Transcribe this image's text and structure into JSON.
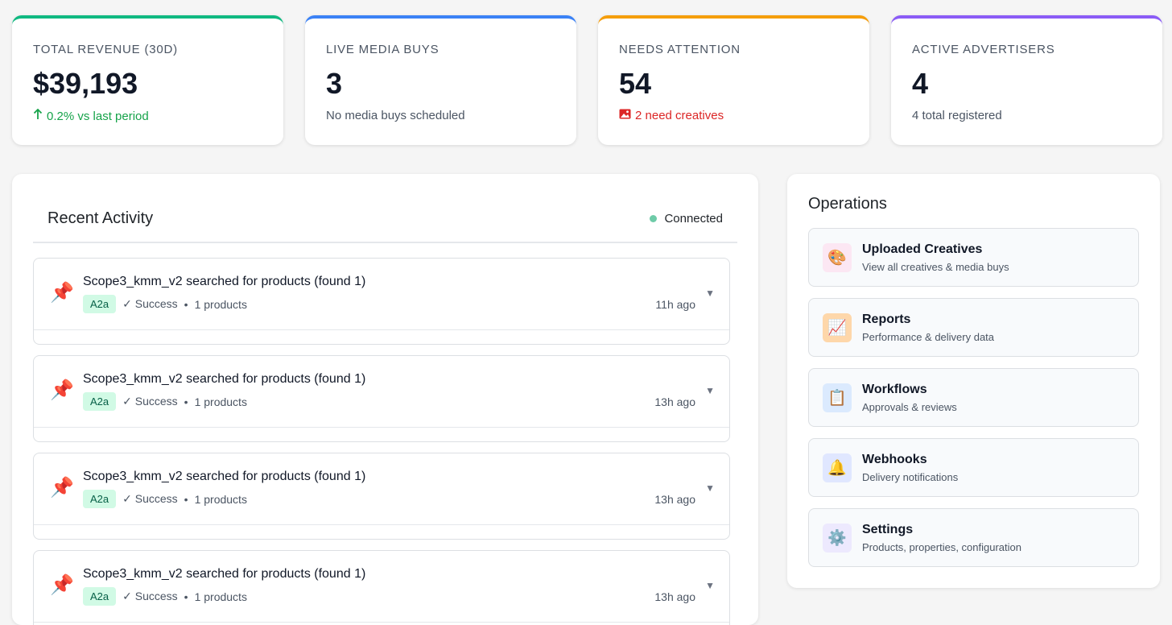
{
  "stats": [
    {
      "label": "TOTAL REVENUE (30D)",
      "value": "$39,193",
      "sub": "0.2% vs last period",
      "sub_icon": "arrow-up-icon",
      "accent": "#10b981"
    },
    {
      "label": "LIVE MEDIA BUYS",
      "value": "3",
      "sub": "No media buys scheduled",
      "accent": "#3b82f6"
    },
    {
      "label": "NEEDS ATTENTION",
      "value": "54",
      "sub": "2 need creatives",
      "sub_icon": "image-icon",
      "accent": "#f59e0b"
    },
    {
      "label": "ACTIVE ADVERTISERS",
      "value": "4",
      "sub": "4 total registered",
      "accent": "#8b5cf6"
    }
  ],
  "activity": {
    "title": "Recent Activity",
    "status": "Connected",
    "items": [
      {
        "title": "Scope3_kmm_v2 searched for products (found 1)",
        "badge": "A2a",
        "result": "✓ Success",
        "detail": "1 products",
        "time": "11h ago"
      },
      {
        "title": "Scope3_kmm_v2 searched for products (found 1)",
        "badge": "A2a",
        "result": "✓ Success",
        "detail": "1 products",
        "time": "13h ago"
      },
      {
        "title": "Scope3_kmm_v2 searched for products (found 1)",
        "badge": "A2a",
        "result": "✓ Success",
        "detail": "1 products",
        "time": "13h ago"
      },
      {
        "title": "Scope3_kmm_v2 searched for products (found 1)",
        "badge": "A2a",
        "result": "✓ Success",
        "detail": "1 products",
        "time": "13h ago"
      }
    ]
  },
  "operations": {
    "title": "Operations",
    "items": [
      {
        "name": "Uploaded Creatives",
        "desc": "View all creatives & media buys",
        "icon": "palette-icon",
        "glyph": "🎨",
        "bg": "#fce7f3"
      },
      {
        "name": "Reports",
        "desc": "Performance & delivery data",
        "icon": "chart-icon",
        "glyph": "📈",
        "bg": "#fed7aa"
      },
      {
        "name": "Workflows",
        "desc": "Approvals & reviews",
        "icon": "clipboard-icon",
        "glyph": "📋",
        "bg": "#dbeafe"
      },
      {
        "name": "Webhooks",
        "desc": "Delivery notifications",
        "icon": "bell-icon",
        "glyph": "🔔",
        "bg": "#e0e7ff"
      },
      {
        "name": "Settings",
        "desc": "Products, properties, configuration",
        "icon": "gear-icon",
        "glyph": "⚙️",
        "bg": "#ede9fe"
      }
    ]
  }
}
